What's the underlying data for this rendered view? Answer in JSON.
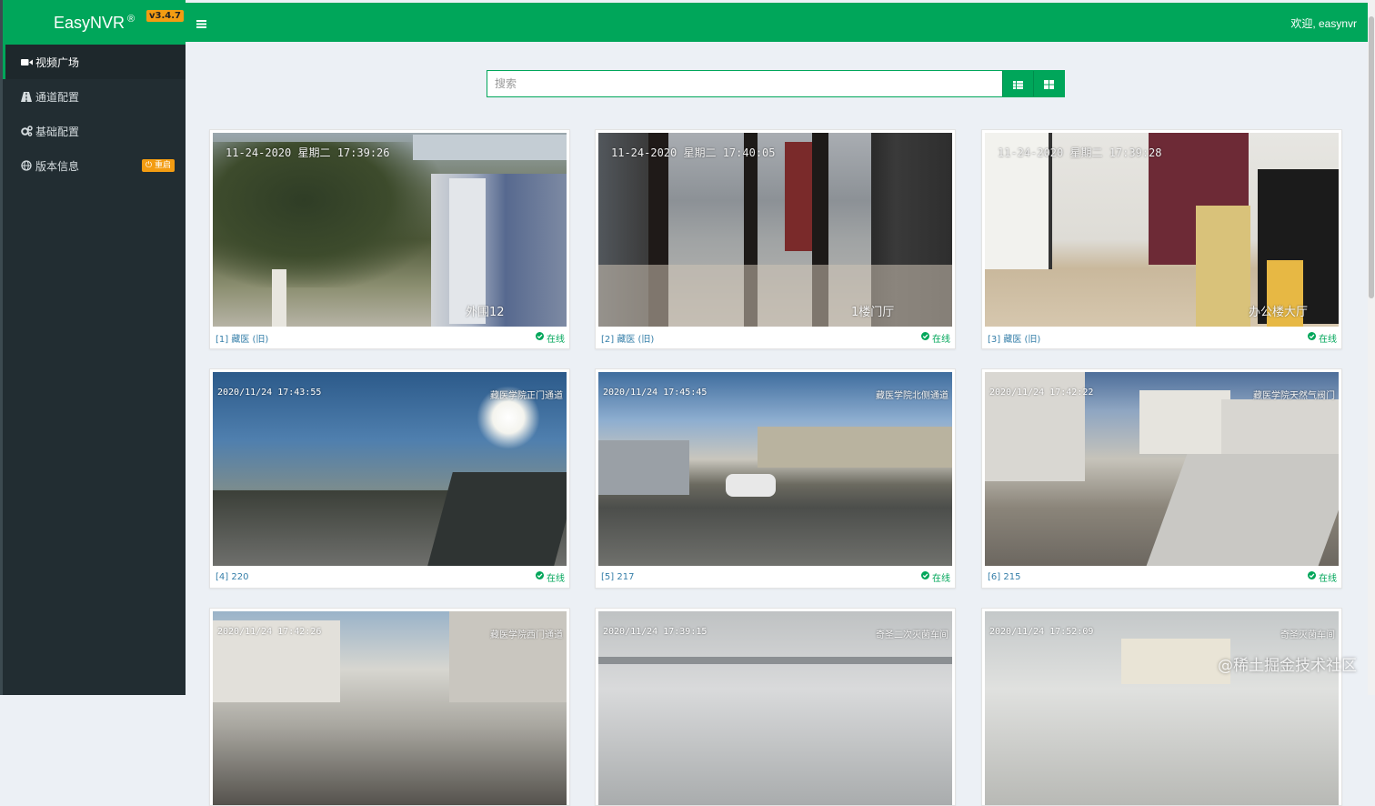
{
  "app": {
    "brand": "EasyNVR",
    "brand_mark": "®",
    "version": "v3.4.7",
    "welcome": "欢迎, easynvr"
  },
  "sidebar": {
    "items": [
      {
        "label": "视频广场",
        "icon": "video-camera-icon",
        "active": true
      },
      {
        "label": "通道配置",
        "icon": "road-icon",
        "active": false
      },
      {
        "label": "基础配置",
        "icon": "gears-icon",
        "active": false
      },
      {
        "label": "版本信息",
        "icon": "globe-icon",
        "active": false,
        "badge": "重启"
      }
    ]
  },
  "search": {
    "placeholder": "搜索",
    "value": ""
  },
  "colors": {
    "primary": "#00a65a",
    "sidebar": "#222d32",
    "badge": "#f39c12",
    "link": "#367fa9"
  },
  "cameras": [
    {
      "title": "[1] 藏医 (旧)",
      "status": "在线",
      "timestamp": "11-24-2020  星期二  17:39:26",
      "location": "外围12",
      "scene": "trees"
    },
    {
      "title": "[2] 藏医 (旧)",
      "status": "在线",
      "timestamp": "11-24-2020  星期二  17:40:05",
      "location": "1楼门厅",
      "scene": "lobby"
    },
    {
      "title": "[3] 藏医 (旧)",
      "status": "在线",
      "timestamp": "11-24-2020  星期二  17:39:28",
      "location": "办公楼大厅",
      "scene": "hall"
    },
    {
      "title": "[4] 220",
      "status": "在线",
      "timestamp": "2020/11/24 17:43:55",
      "location": "藏医学院正门通道",
      "scene": "road-sun"
    },
    {
      "title": "[5] 217",
      "status": "在线",
      "timestamp": "2020/11/24 17:45:45",
      "location": "藏医学院北侧通道",
      "scene": "parking"
    },
    {
      "title": "[6] 215",
      "status": "在线",
      "timestamp": "2020/11/24 17:42:22",
      "location": "藏医学院天然气阀门",
      "scene": "buildings"
    },
    {
      "title": "",
      "status": "",
      "timestamp": "2020/11/24 17:42:26",
      "location": "藏医学院西门通道",
      "scene": "street"
    },
    {
      "title": "",
      "status": "",
      "timestamp": "2020/11/24 17:39:15",
      "location": "奇圣二次灭菌车间",
      "scene": "workshop"
    },
    {
      "title": "",
      "status": "",
      "timestamp": "2020/11/24 17:52:09",
      "location": "奇圣灭菌车间",
      "scene": "workshop2"
    }
  ],
  "watermark": "@稀土掘金技术社区"
}
